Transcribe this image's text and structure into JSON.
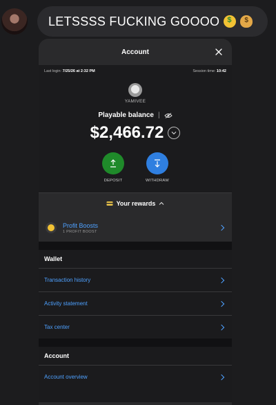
{
  "message": {
    "text": "LETSSSS FUCKING GOOOO",
    "emojis": [
      "money-mouth-face-emoji",
      "money-bag-emoji"
    ]
  },
  "account_panel": {
    "title": "Account",
    "last_login_label": "Last login:",
    "last_login_value": "7/25/26 at 2:32 PM",
    "session_time_label": "Session time:",
    "session_time_value": "10:42",
    "username": "YAMIVEE",
    "playable_balance_label": "Playable balance",
    "balance": "$2,466.72",
    "actions": [
      {
        "label": "DEPOSIT",
        "color": "#1f8a2a"
      },
      {
        "label": "WITHDRAW",
        "color": "#2f7fe0"
      }
    ],
    "rewards": {
      "heading": "Your rewards",
      "item_title": "Profit Boosts",
      "item_subtitle": "1 PROFIT BOOST"
    },
    "wallet": {
      "heading": "Wallet",
      "items": [
        "Transaction history",
        "Activity statement",
        "Tax center"
      ]
    },
    "account_section": {
      "heading": "Account",
      "items": [
        "Account overview"
      ]
    }
  },
  "colors": {
    "link": "#4ea1ff",
    "background": "#1c1c1e",
    "panel": "#2a2a2c"
  }
}
